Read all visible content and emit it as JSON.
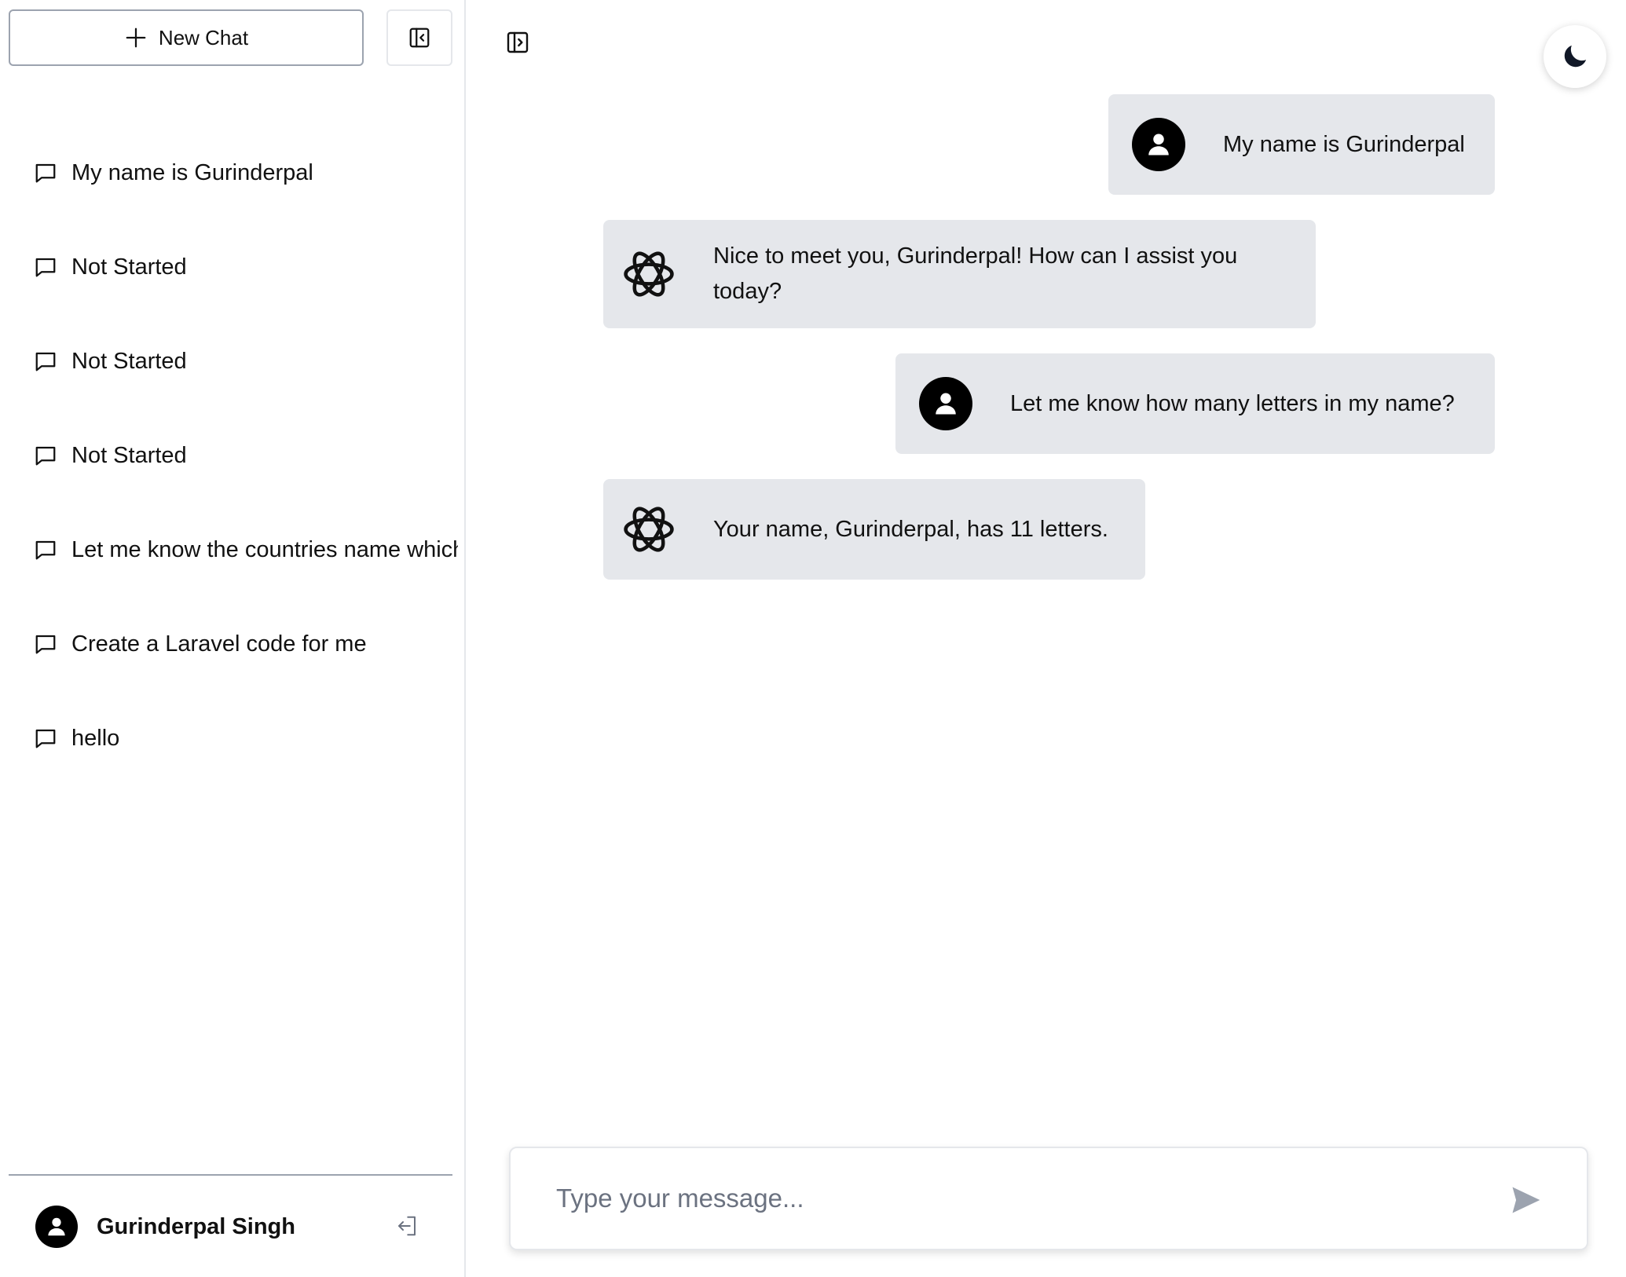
{
  "sidebar": {
    "new_chat_label": "New Chat",
    "history": [
      {
        "label": "My name is Gurinderpal"
      },
      {
        "label": "Not Started"
      },
      {
        "label": "Not Started"
      },
      {
        "label": "Not Started"
      },
      {
        "label": "Let me know the countries name which"
      },
      {
        "label": "Create a Laravel code for me"
      },
      {
        "label": "hello"
      }
    ],
    "user": {
      "name": "Gurinderpal Singh"
    }
  },
  "chat": {
    "messages": [
      {
        "role": "user",
        "text": "My name is Gurinderpal"
      },
      {
        "role": "assistant",
        "text": "Nice to meet you, Gurinderpal! How can I assist you today?"
      },
      {
        "role": "user",
        "text": "Let me know how many letters in my name?"
      },
      {
        "role": "assistant",
        "text": "Your name, Gurinderpal, has 11 letters."
      }
    ]
  },
  "composer": {
    "placeholder": "Type your message...",
    "value": ""
  },
  "icons": {
    "new_chat": "plus-icon",
    "collapse_sidebar": "sidebar-collapse-icon",
    "history_item": "chat-bubble-icon",
    "logout": "logout-icon",
    "expand_sidebar": "sidebar-expand-icon",
    "theme": "moon-icon",
    "send": "send-icon",
    "user_avatar": "user-avatar-icon",
    "assistant_avatar": "openai-logo-icon"
  },
  "colors": {
    "bubble_bg": "#e5e7eb",
    "text": "#111111",
    "border": "#9ca3af",
    "send_icon": "#9ca3af"
  }
}
